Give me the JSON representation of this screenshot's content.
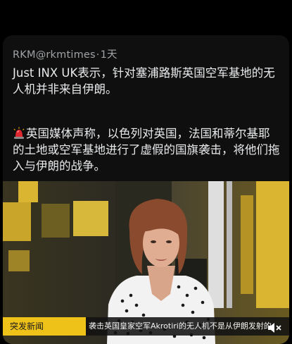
{
  "tweet": {
    "author_handle": "RKM@rkmtimes",
    "separator": "·",
    "time": "1天",
    "paragraph1": "Just INX UK表示，针对塞浦路斯英国空军基地的无人机并非来自伊朗。",
    "paragraph2": "英国媒体声称，以色列对英国，法国和蒂尔基耶的土地或空军基地进行了虚假的国旗袭击，将他们拖入与伊朗的战争。",
    "paragraph2_emoji": "police-light-icon"
  },
  "video": {
    "badge_label": "突发新闻",
    "ticker_text": "袭击英国皇家空军Akrotiri的无人机不是从伊朗发射的",
    "mute_icon": "speaker-muted-icon",
    "colors": {
      "badge": "#efc21a",
      "ticker_bg": "#121212"
    }
  }
}
